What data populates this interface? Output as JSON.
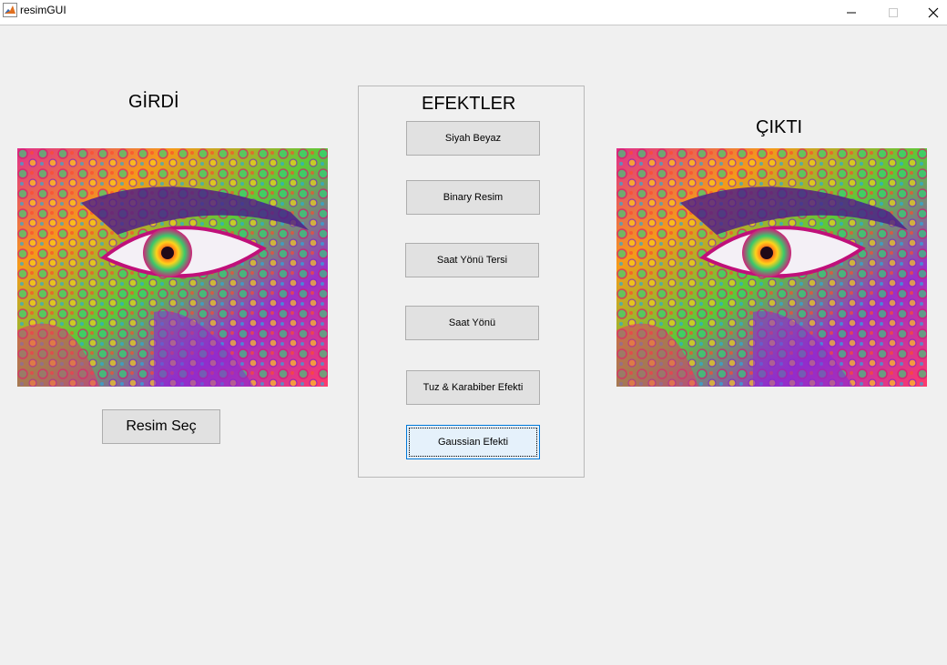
{
  "window": {
    "title": "resimGUI",
    "icon": "matlab-icon",
    "controls": [
      "minimize-icon",
      "maximize-icon",
      "close-icon"
    ]
  },
  "input": {
    "heading": "GİRDİ",
    "image": "psychedelic-eye-artwork",
    "select_button": "Resim Seç"
  },
  "effects": {
    "heading": "EFEKTLER",
    "buttons": [
      "Siyah Beyaz",
      "Binary Resim",
      "Saat Yönü Tersi",
      "Saat Yönü",
      "Tuz & Karabiber Efekti",
      "Gaussian Efekti"
    ],
    "focused_button": "Gaussian Efekti"
  },
  "output": {
    "heading": "ÇIKTI",
    "image": "psychedelic-eye-artwork"
  },
  "colors": {
    "background": "#f0f0f0",
    "button": "#e1e1e1",
    "button_border": "#adadad",
    "focus_border": "#0078d7",
    "focus_fill": "#e5f1fb"
  }
}
